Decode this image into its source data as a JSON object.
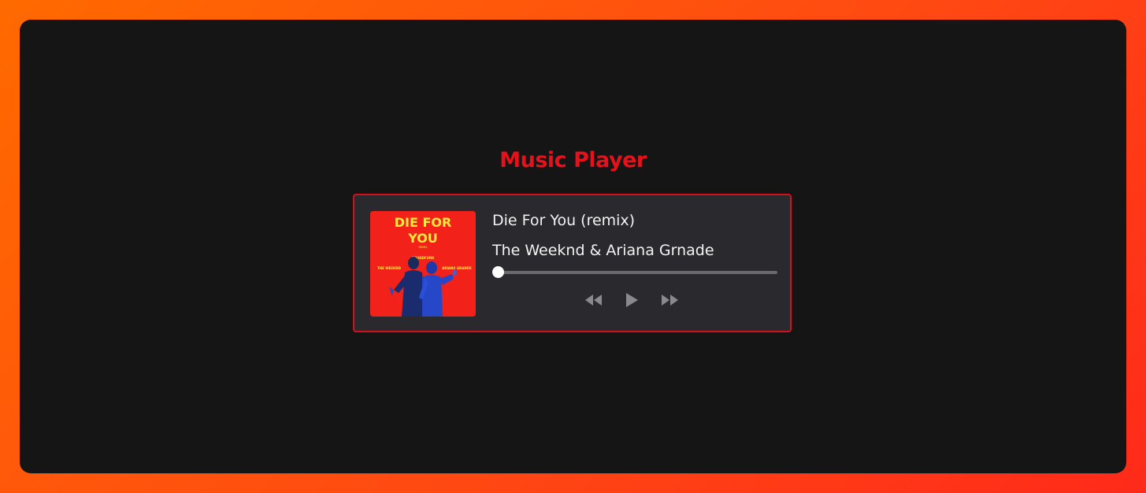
{
  "page": {
    "title": "Music Player"
  },
  "player": {
    "cover_art": {
      "title": "DIE FOR YOU",
      "subtitle": "REMIX",
      "credit_top": "SOUNDFUNK",
      "artist_left": "THE WEEKND",
      "artist_right": "ARIANA GRANDE"
    },
    "song_title": "Die For You (remix)",
    "artist": "The Weeknd & Ariana Grnade",
    "progress": 0,
    "controls": {
      "previous_icon": "rewind-icon",
      "play_icon": "play-icon",
      "next_icon": "fast-forward-icon"
    }
  },
  "colors": {
    "accent": "#e8101a",
    "card_border": "#d4111a",
    "frame_bg": "#151515",
    "card_bg": "#2a2a2e",
    "control_gray": "#8a8a8e"
  }
}
